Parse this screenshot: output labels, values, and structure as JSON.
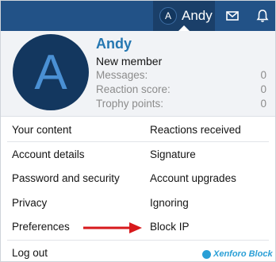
{
  "topbar": {
    "user_initial": "A",
    "username": "Andy",
    "icons": [
      "envelope-icon",
      "bell-icon"
    ],
    "colors": {
      "bar": "#225287",
      "active_tab": "#1a3f69"
    }
  },
  "profile": {
    "avatar_letter": "A",
    "name": "Andy",
    "user_title": "New member",
    "stats": [
      {
        "label": "Messages:",
        "value": "0"
      },
      {
        "label": "Reaction score:",
        "value": "0"
      },
      {
        "label": "Trophy points:",
        "value": "0"
      }
    ]
  },
  "menu": {
    "left": [
      "Your content",
      "Account details",
      "Password and security",
      "Privacy",
      "Preferences"
    ],
    "right": [
      "Reactions received",
      "Signature",
      "Account upgrades",
      "Ignoring",
      "Block IP"
    ],
    "logout": "Log out"
  },
  "annotation": {
    "arrow_color": "#d7191c"
  },
  "watermark": "Xenforo Block"
}
